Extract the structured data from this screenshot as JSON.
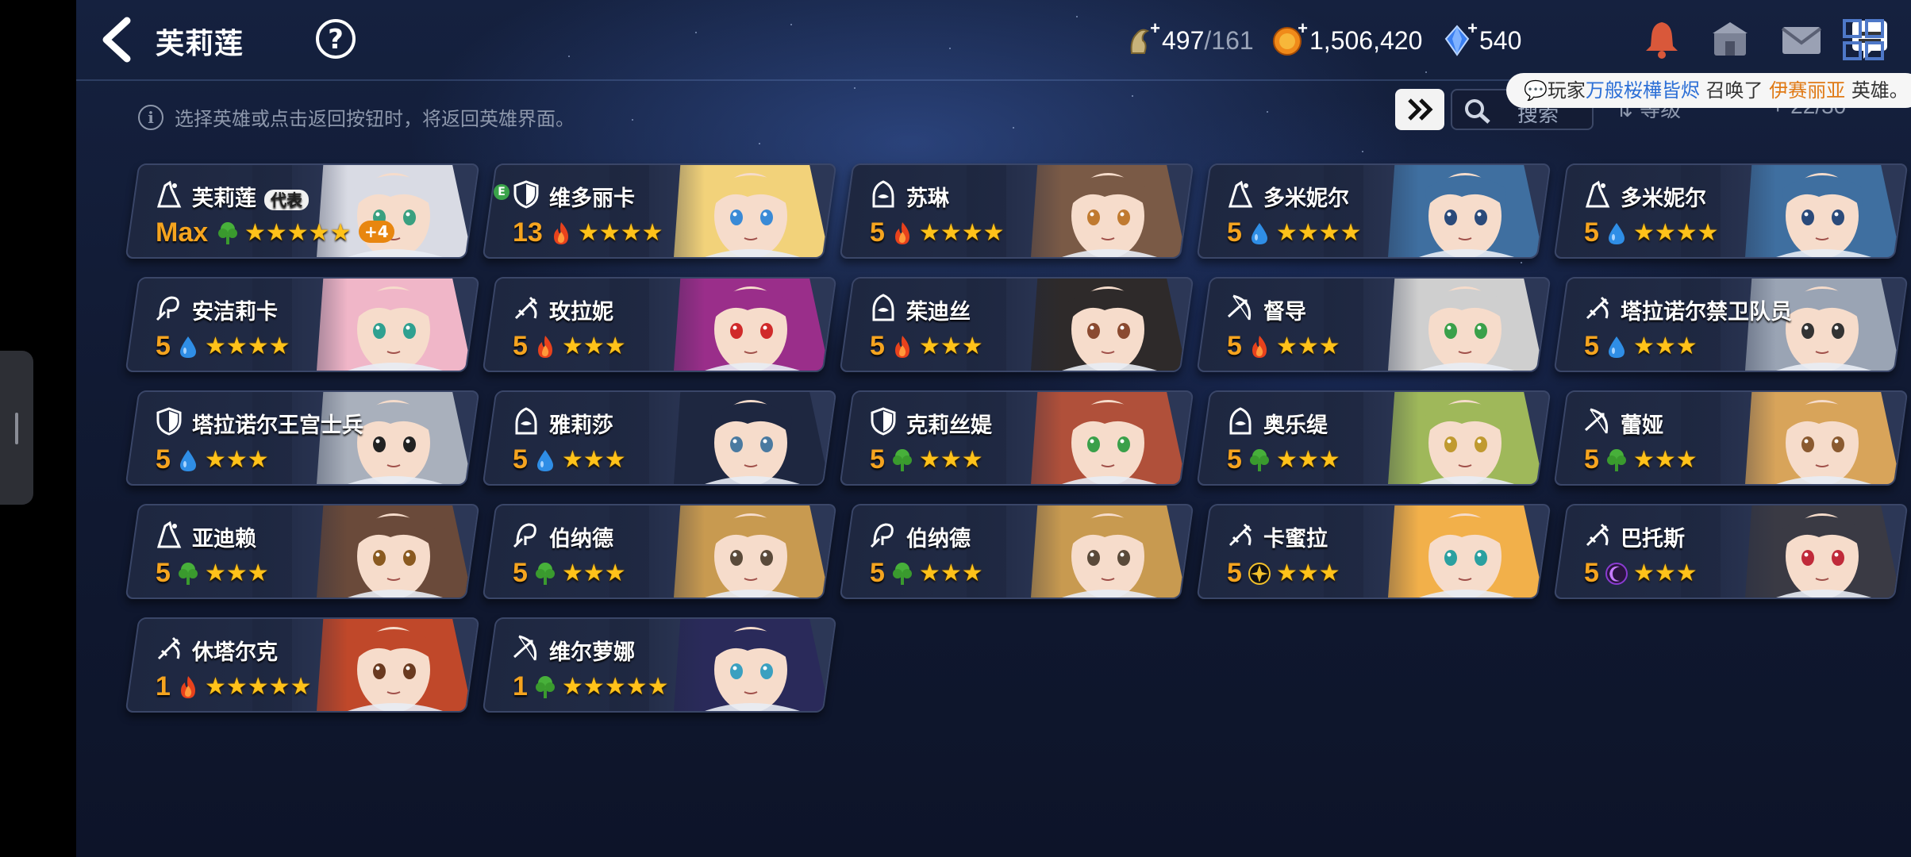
{
  "header": {
    "title": "芙莉莲",
    "help_label": "?",
    "stamina": {
      "current": "497",
      "max": "/161"
    },
    "gold": "1,506,420",
    "gems": "540"
  },
  "notice": {
    "prefix": "玩家",
    "player": "万般桜樺皆烬",
    "middle": "召唤了",
    "hero": "伊赛丽亚",
    "suffix": "英雄。"
  },
  "hint": "选择英雄或点击返回按钮时，将返回英雄界面。",
  "search": {
    "placeholder": "搜索"
  },
  "sort": {
    "label": "等级"
  },
  "count": "22/30",
  "colors": {
    "accent": "#f5a41f",
    "star": "#ffc21a",
    "fire": "#e8421c",
    "water": "#2f8ee6",
    "wood": "#47b03a",
    "light": "#f3c12c",
    "dark": "#8a3bd1"
  },
  "heroes": [
    {
      "name": "芙莉莲",
      "tag": "代表",
      "level": "Max",
      "element": "wood",
      "stars": "★★★★★",
      "plus": "+4",
      "cls": "mage",
      "e_badge": "",
      "hair": "#d9dbe4",
      "eye": "#3aa080"
    },
    {
      "name": "维多丽卡",
      "tag": "",
      "level": "13",
      "element": "fire",
      "stars": "★★★★",
      "plus": "",
      "cls": "guard",
      "e_badge": "E",
      "hair": "#f2d27a",
      "eye": "#3a8ad6"
    },
    {
      "name": "苏琳",
      "tag": "",
      "level": "5",
      "element": "fire",
      "stars": "★★★★",
      "plus": "",
      "cls": "rogue",
      "e_badge": "",
      "hair": "#7a5a46",
      "eye": "#c07a30"
    },
    {
      "name": "多米妮尔",
      "tag": "",
      "level": "5",
      "element": "water",
      "stars": "★★★★",
      "plus": "",
      "cls": "mage",
      "e_badge": "",
      "hair": "#3f6fa0",
      "eye": "#2a4a7a"
    },
    {
      "name": "多米妮尔",
      "tag": "",
      "level": "5",
      "element": "water",
      "stars": "★★★★",
      "plus": "",
      "cls": "mage",
      "e_badge": "",
      "hair": "#3f6fa0",
      "eye": "#2a4a7a"
    },
    {
      "name": "安洁莉卡",
      "tag": "",
      "level": "5",
      "element": "water",
      "stars": "★★★★",
      "plus": "",
      "cls": "priest",
      "e_badge": "",
      "hair": "#f0b6c8",
      "eye": "#2fa090"
    },
    {
      "name": "玫拉妮",
      "tag": "",
      "level": "5",
      "element": "fire",
      "stars": "★★★",
      "plus": "",
      "cls": "warrior",
      "e_badge": "",
      "hair": "#9a2e8a",
      "eye": "#d02a2a"
    },
    {
      "name": "茱迪丝",
      "tag": "",
      "level": "5",
      "element": "fire",
      "stars": "★★★",
      "plus": "",
      "cls": "rogue",
      "e_badge": "",
      "hair": "#2e2a2a",
      "eye": "#8a4a30"
    },
    {
      "name": "督导",
      "tag": "",
      "level": "5",
      "element": "fire",
      "stars": "★★★",
      "plus": "",
      "cls": "archer",
      "e_badge": "",
      "hair": "#cfcfcf",
      "eye": "#3aa04a"
    },
    {
      "name": "塔拉诺尔禁卫队员",
      "tag": "",
      "level": "5",
      "element": "water",
      "stars": "★★★",
      "plus": "",
      "cls": "warrior",
      "e_badge": "",
      "hair": "#9aa4b4",
      "eye": "#333333"
    },
    {
      "name": "塔拉诺尔王宫士兵",
      "tag": "",
      "level": "5",
      "element": "water",
      "stars": "★★★",
      "plus": "",
      "cls": "guard",
      "e_badge": "",
      "hair": "#a9b0bc",
      "eye": "#222222"
    },
    {
      "name": "雅莉莎",
      "tag": "",
      "level": "5",
      "element": "water",
      "stars": "★★★",
      "plus": "",
      "cls": "rogue",
      "e_badge": "",
      "hair": "#1e2740",
      "eye": "#4a7aa0"
    },
    {
      "name": "克莉丝媞",
      "tag": "",
      "level": "5",
      "element": "wood",
      "stars": "★★★",
      "plus": "",
      "cls": "guard",
      "e_badge": "",
      "hair": "#b0503a",
      "eye": "#3aa04a"
    },
    {
      "name": "奥乐缇",
      "tag": "",
      "level": "5",
      "element": "wood",
      "stars": "★★★",
      "plus": "",
      "cls": "rogue",
      "e_badge": "",
      "hair": "#9fb85a",
      "eye": "#c09a30"
    },
    {
      "name": "蕾娅",
      "tag": "",
      "level": "5",
      "element": "wood",
      "stars": "★★★",
      "plus": "",
      "cls": "archer",
      "e_badge": "",
      "hair": "#d8a45a",
      "eye": "#8a5a30"
    },
    {
      "name": "亚迪赖",
      "tag": "",
      "level": "5",
      "element": "wood",
      "stars": "★★★",
      "plus": "",
      "cls": "mage",
      "e_badge": "",
      "hair": "#6a4a3a",
      "eye": "#8a5a20"
    },
    {
      "name": "伯纳德",
      "tag": "",
      "level": "5",
      "element": "wood",
      "stars": "★★★",
      "plus": "",
      "cls": "priest",
      "e_badge": "",
      "hair": "#c89a50",
      "eye": "#5a4a3a"
    },
    {
      "name": "伯纳德",
      "tag": "",
      "level": "5",
      "element": "wood",
      "stars": "★★★",
      "plus": "",
      "cls": "priest",
      "e_badge": "",
      "hair": "#c89a50",
      "eye": "#5a4a3a"
    },
    {
      "name": "卡蜜拉",
      "tag": "",
      "level": "5",
      "element": "light",
      "stars": "★★★",
      "plus": "",
      "cls": "warrior",
      "e_badge": "",
      "hair": "#f2b04a",
      "eye": "#2aa0a0"
    },
    {
      "name": "巴托斯",
      "tag": "",
      "level": "5",
      "element": "dark",
      "stars": "★★★",
      "plus": "",
      "cls": "warrior",
      "e_badge": "",
      "hair": "#3a3a44",
      "eye": "#c02a3a"
    },
    {
      "name": "休塔尔克",
      "tag": "",
      "level": "1",
      "element": "fire",
      "stars": "★★★★★",
      "plus": "",
      "cls": "warrior",
      "e_badge": "",
      "hair": "#c0482a",
      "eye": "#6a3a20"
    },
    {
      "name": "维尔萝娜",
      "tag": "",
      "level": "1",
      "element": "wood",
      "stars": "★★★★★",
      "plus": "",
      "cls": "archer",
      "e_badge": "",
      "hair": "#2a2a5a",
      "eye": "#3aa0c0"
    }
  ]
}
